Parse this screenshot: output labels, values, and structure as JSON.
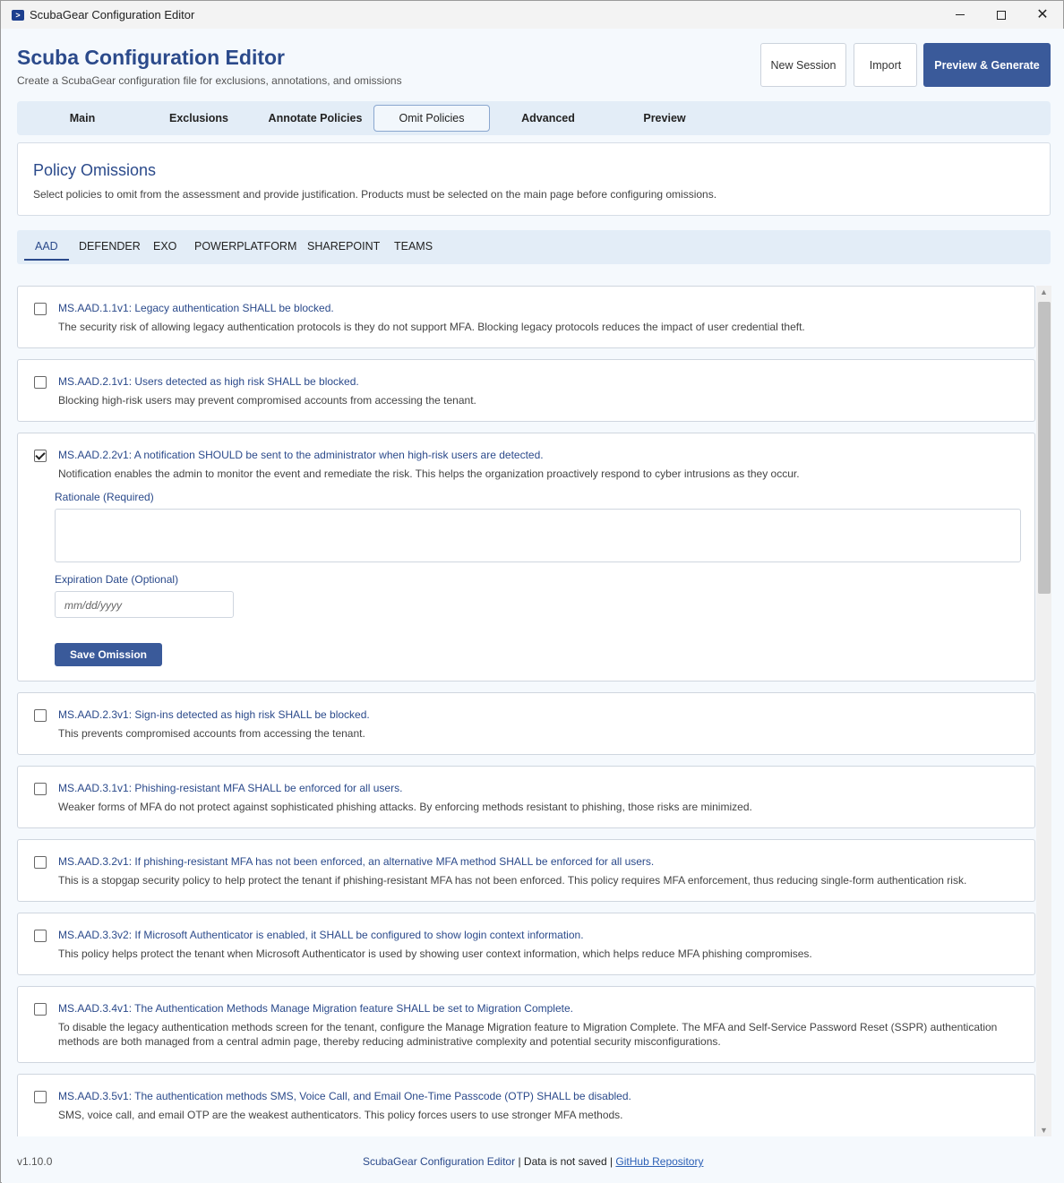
{
  "window": {
    "title": "ScubaGear Configuration Editor"
  },
  "header": {
    "title": "Scuba Configuration Editor",
    "subtitle": "Create a ScubaGear configuration file for exclusions, annotations, and omissions",
    "buttons": {
      "new_session": "New Session",
      "import": "Import",
      "preview_generate": "Preview & Generate"
    }
  },
  "main_tabs": [
    "Main",
    "Exclusions",
    "Annotate Policies",
    "Omit Policies",
    "Advanced",
    "Preview"
  ],
  "active_main_tab": "Omit Policies",
  "section": {
    "title": "Policy Omissions",
    "description": "Select policies to omit from the assessment and provide justification. Products must be selected on the main page before configuring omissions."
  },
  "product_tabs": [
    "AAD",
    "DEFENDER",
    "EXO",
    "POWERPLATFORM",
    "SHAREPOINT",
    "TEAMS"
  ],
  "active_product_tab": "AAD",
  "policies": [
    {
      "title": "MS.AAD.1.1v1: Legacy authentication SHALL be blocked.",
      "description": "The security risk of allowing legacy authentication protocols is they do not support MFA. Blocking legacy protocols reduces the impact of user credential theft.",
      "checked": false
    },
    {
      "title": "MS.AAD.2.1v1: Users detected as high risk SHALL be blocked.",
      "description": "Blocking high-risk users may prevent compromised accounts from accessing the tenant.",
      "checked": false
    },
    {
      "title": "MS.AAD.2.2v1: A notification SHOULD be sent to the administrator when high-risk users are detected.",
      "description": "Notification enables the admin to monitor the event and remediate the risk. This helps the organization proactively respond to cyber intrusions as they occur.",
      "checked": true
    },
    {
      "title": "MS.AAD.2.3v1: Sign-ins detected as high risk SHALL be blocked.",
      "description": "This prevents compromised accounts from accessing the tenant.",
      "checked": false
    },
    {
      "title": "MS.AAD.3.1v1: Phishing-resistant MFA SHALL be enforced for all users.",
      "description": "Weaker forms of MFA do not protect against sophisticated phishing attacks. By enforcing methods resistant to phishing, those risks are minimized.",
      "checked": false
    },
    {
      "title": "MS.AAD.3.2v1: If phishing-resistant MFA has not been enforced, an alternative MFA method SHALL be enforced for all users.",
      "description": "This is a stopgap security policy to help protect the tenant if phishing-resistant MFA has not been enforced. This policy requires MFA enforcement, thus reducing single-form authentication risk.",
      "checked": false
    },
    {
      "title": "MS.AAD.3.3v2: If Microsoft Authenticator is enabled, it SHALL be configured to show login context information.",
      "description": "This policy helps protect the tenant when Microsoft Authenticator is used by showing user context information, which helps reduce MFA phishing compromises.",
      "checked": false
    },
    {
      "title": "MS.AAD.3.4v1: The Authentication Methods Manage Migration feature SHALL be set to Migration Complete.",
      "description": "To disable the legacy authentication methods screen for the tenant, configure the Manage Migration feature to Migration Complete. The MFA and Self-Service Password Reset (SSPR) authentication methods are both managed from a central admin page, thereby reducing administrative complexity and potential security misconfigurations.",
      "checked": false
    },
    {
      "title": "MS.AAD.3.5v1: The authentication methods SMS, Voice Call, and Email One-Time Passcode (OTP) SHALL be disabled.",
      "description": "SMS, voice call, and email OTP are the weakest authenticators. This policy forces users to use stronger MFA methods.",
      "checked": false
    }
  ],
  "omission_form": {
    "rationale_label": "Rationale (Required)",
    "expiration_label": "Expiration Date (Optional)",
    "date_placeholder": "mm/dd/yyyy",
    "save_label": "Save Omission"
  },
  "footer": {
    "version": "v1.10.0",
    "app_name": "ScubaGear Configuration Editor",
    "separator": " | ",
    "status": "Data is not saved",
    "link": "GitHub Repository"
  }
}
